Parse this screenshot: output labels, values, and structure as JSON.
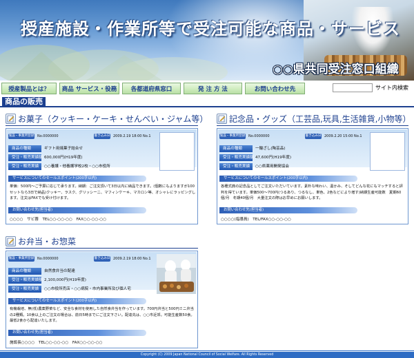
{
  "header": {
    "title": "授産施設・作業所等で受注可能な商品・サービス",
    "org": "○○県共同受注窓口組織"
  },
  "nav": {
    "items": [
      "授産製品とは？",
      "商品 サービス・役務",
      "各都道府県窓口",
      "発 注 方 法",
      "お問い合わせ先"
    ],
    "search_label": "サイト内検索",
    "search_value": ""
  },
  "section_title": "商品の販売",
  "categories": {
    "sweets": "お菓子（クッキー・ケーキ・せんべい・ジャム等）",
    "goods": "記念品・グッズ（工芸品,玩具,生活雑貨,小物等）",
    "bento": "お弁当・お惣菜"
  },
  "cards": [
    {
      "reg_label": "施設・事業所登録",
      "reg_no": "No.0000000",
      "updated_label": "書き込み日",
      "updated": "2009.2.19 18:00 No.1",
      "rows": [
        {
          "label": "商品の種類",
          "value": "ギフト用焼菓子詰合せ"
        },
        {
          "label": "受注・販売実績額",
          "value": "600,000円(H19年度)"
        },
        {
          "label": "受注・販売実績",
          "value": "○○養護・他養護学校2校・○○市役所"
        }
      ],
      "sales_label": "サービスについてのセールスポイント(200字以内)",
      "sales_text": "単価：500円～ご予算に応じて承ります。納期：ご注文頂いて3日以内に納品できます。(個数にもよりますが100セットなら3日で納品)クッキー、ラスク、グリッシーニ、マフィンケーキ、マカロン等、オシャレにラッピングします。注文はFAXでも受け付けます。",
      "contact_label": "お問い合わせ先(担当者)",
      "contact": "○○○○　サビ蓉　TEL○○-○○-○○　FAX○○-○○-○○"
    },
    {
      "reg_label": "施設・事業所登録",
      "reg_no": "No.0000000",
      "updated_label": "書き込み日",
      "updated": "2009.2.20 15:00 No.1",
      "rows": [
        {
          "label": "商品の種類",
          "value": "一輪ざし(陶芸品)"
        },
        {
          "label": "受注・販売実績額",
          "value": "47,600円(H19年度)"
        },
        {
          "label": "受注・販売実績",
          "value": "○○県薬用開発協会"
        }
      ],
      "sales_label": "サービスについてのセールスポイント(200字以内)",
      "sales_text": "各種式典の記念品としてご注文いただいています。素朴な味わい、温かみ、そしてどんな花にもマッチすると評判を得ています。単価500～700円(つるあり、つるなし、単色、2色などにより増す)納期生産可能数　夏期60個/月　冬期40個/月　大量注文の際はお早めにお願いします。",
      "contact_label": "お問い合わせ先(担当者)",
      "contact": "○○○○(指導員)　TEL/FAX○○-○○-○○"
    },
    {
      "reg_label": "施設・事業所登録",
      "reg_no": "No.0000000",
      "updated_label": "書き込み日",
      "updated": "2009.2.19 18:00 No.1",
      "rows": [
        {
          "label": "商品の種類",
          "value": "自然食弁当の配達"
        },
        {
          "label": "受注・販売実績額",
          "value": "2,100,000円(H19年度)"
        },
        {
          "label": "受注・販売実績",
          "value": "○○市役所売店・○○病院・市内事業所及び個人宅"
        }
      ],
      "sales_label": "サービスについてのセールスポイント(200字以内)",
      "sales_text": "有機栽培、無(低)農薬野菜など、安全な食材を使用した自然食弁当を作っています。700円弁当と500円ミニ弁当の2種類。10食以上のご注文の場合は、前日5時までにご注文下さい。配達先は、○○市近郊。可能生産数50食。最低2食から配達いたします。",
      "contact_label": "お問い合わせ先(担当者)",
      "contact": "施設長○○○○　TEL○○-○○-○○　FAX○○-○○-○○"
    }
  ],
  "footer": "Copyright (C) 2009 Japan National Council of Social Welfare. All Rights Reserved",
  "colors": {
    "accent": "#1c3f8f",
    "nav_bg": "#cfecbf",
    "label_blue": "#2f61b7",
    "footer": "#2e6cc4"
  }
}
